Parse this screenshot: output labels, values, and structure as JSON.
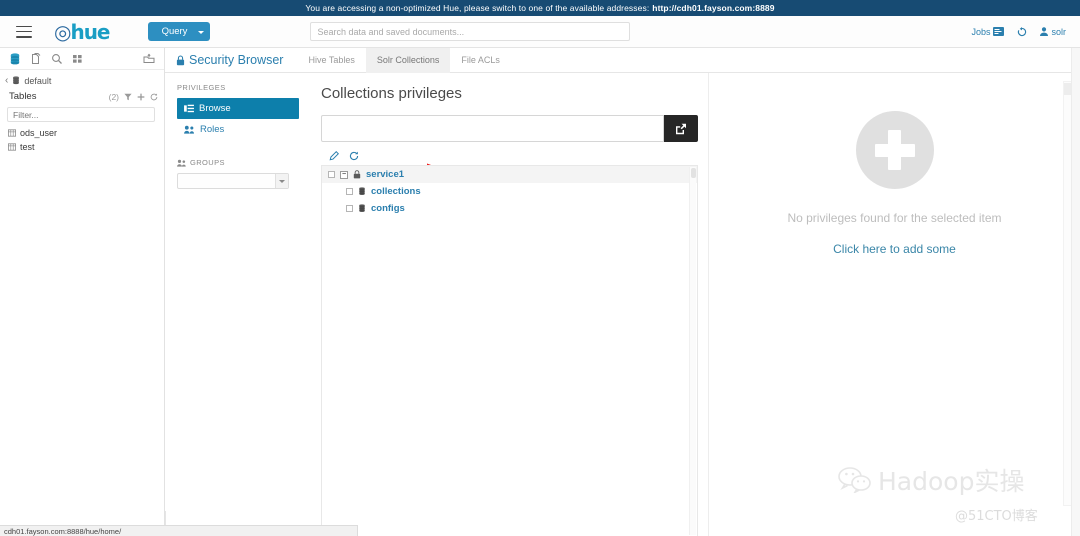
{
  "banner": {
    "message": "You are accessing a non-optimized Hue, please switch to one of the available addresses:",
    "address": "http://cdh01.fayson.com:8889"
  },
  "navbar": {
    "logo": "hue",
    "query_button": "Query",
    "search_placeholder": "Search data and saved documents...",
    "search_value": "",
    "jobs_label": "Jobs",
    "user_label": "solr",
    "icons": {
      "menu": "hamburger-icon",
      "jobs": "jobs-icon",
      "history": "history-icon",
      "user": "user-icon"
    }
  },
  "assist": {
    "tabs": [
      "database-icon",
      "documents-icon",
      "search-icon",
      "apps-grid-icon"
    ],
    "upload_icon": "upload-folder-icon",
    "database": "default",
    "tables_label": "Tables",
    "tables_count": "(2)",
    "filter_placeholder": "Filter...",
    "filter_value": "",
    "row_icons": [
      "filter-icon",
      "plus-icon",
      "refresh-icon"
    ],
    "tables": [
      "ods_user",
      "test"
    ]
  },
  "security": {
    "title": "Security Browser",
    "tabs": [
      {
        "label": "Hive Tables",
        "active": false
      },
      {
        "label": "Solr Collections",
        "active": true
      },
      {
        "label": "File ACLs",
        "active": false
      }
    ],
    "privileges_header": "PRIVILEGES",
    "privileges_items": [
      {
        "label": "Browse",
        "icon": "browse-icon",
        "active": true
      },
      {
        "label": "Roles",
        "icon": "roles-icon",
        "active": false
      }
    ],
    "groups_header": "GROUPS",
    "groups_selected": "",
    "annotation": "red-arrow-pointing-to-roles"
  },
  "collections": {
    "page_title": "Collections privileges",
    "path_value": "",
    "path_button_icon": "external-link-icon",
    "tools": [
      "edit-icon",
      "refresh-icon"
    ],
    "tree": [
      {
        "label": "service1",
        "level": 0,
        "icon": "lock-icon",
        "expanded": true,
        "checked": false
      },
      {
        "label": "collections",
        "level": 1,
        "icon": "collection-icon",
        "checked": false
      },
      {
        "label": "configs",
        "level": 1,
        "icon": "collection-icon",
        "checked": false
      }
    ]
  },
  "empty_state": {
    "icon": "plus-circle-icon",
    "message": "No privileges found for the selected item",
    "link": "Click here to add some"
  },
  "watermarks": {
    "hadoop": "Hadoop实操",
    "cto": "@51CTO博客",
    "wechat_icon": "wechat-icon"
  },
  "statusbar": {
    "url": "cdh01.fayson.com:8888/hue/home/"
  },
  "colors": {
    "banner_bg": "#174b73",
    "accent": "#2b7fae",
    "active_item": "#0d7fab",
    "query_button": "#2d8fc1",
    "dark_button": "#262626",
    "annotation_red": "#ee1c1c"
  }
}
